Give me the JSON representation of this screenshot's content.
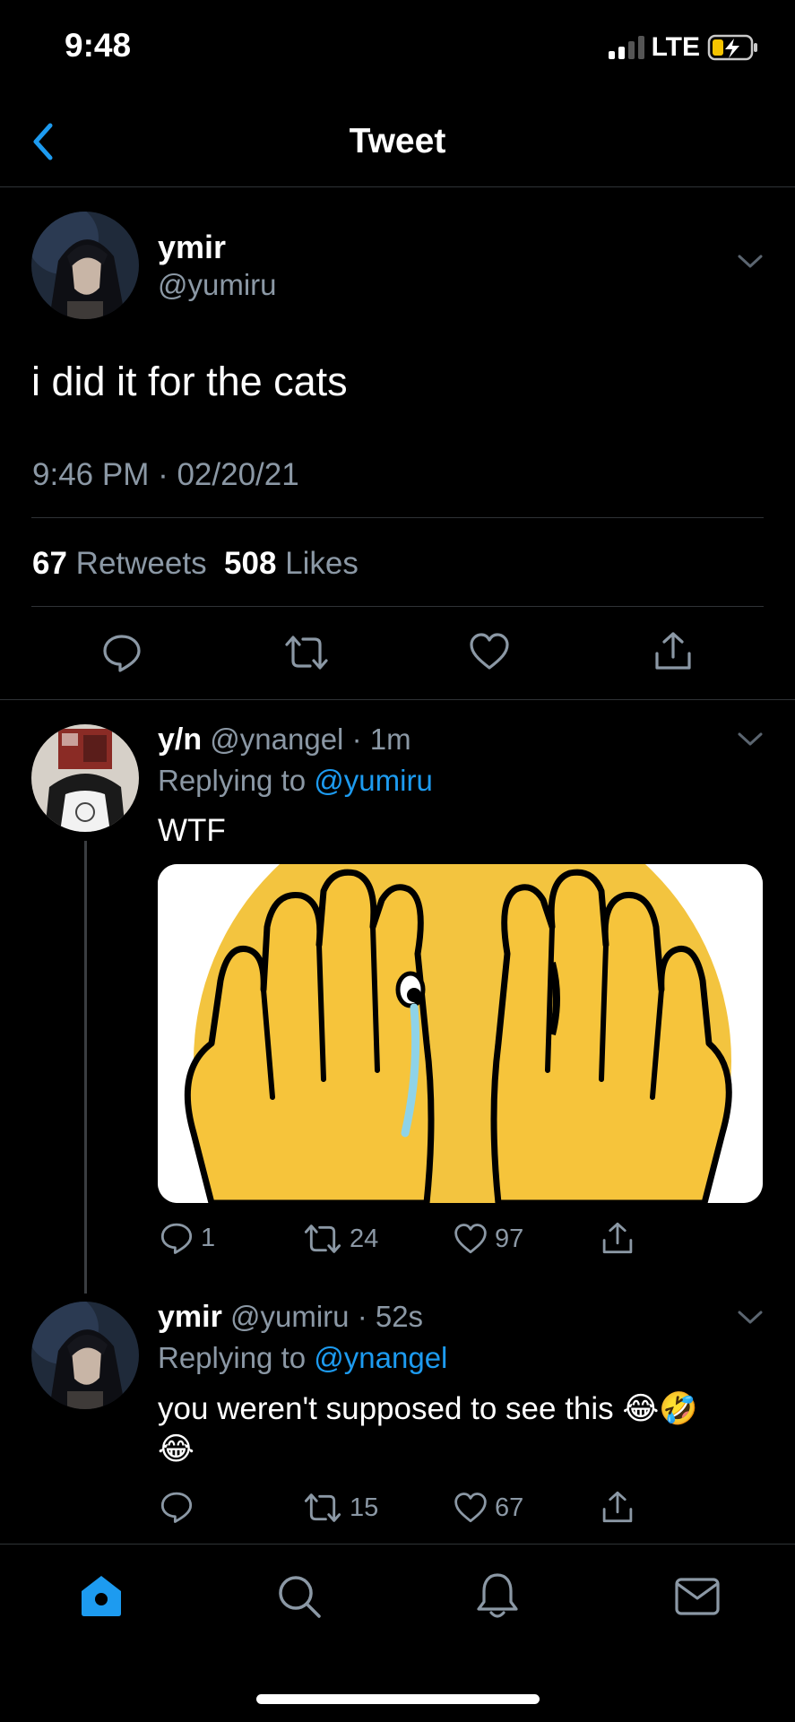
{
  "status_bar": {
    "time": "9:48",
    "network": "LTE"
  },
  "header": {
    "title": "Tweet"
  },
  "main_tweet": {
    "name": "ymir",
    "handle": "@yumiru",
    "text": "i did it for the cats",
    "timestamp": "9:46 PM · 02/20/21",
    "retweets_count": "67",
    "retweets_label": "Retweets",
    "likes_count": "508",
    "likes_label": "Likes"
  },
  "replies": [
    {
      "name": "y/n",
      "handle": "@ynangel",
      "time": "· 1m",
      "replying_prefix": "Replying to",
      "replying_to": "@yumiru",
      "text": "WTF",
      "reply_count": "1",
      "retweet_count": "24",
      "like_count": "97"
    },
    {
      "name": "ymir",
      "handle": "@yumiru",
      "time": "· 52s",
      "replying_prefix": "Replying to",
      "replying_to": "@ynangel",
      "text": "you weren't supposed to see this 😂🤣",
      "text_line2": "😂",
      "reply_count": "",
      "retweet_count": "15",
      "like_count": "67"
    }
  ],
  "tab_bar": {
    "items": [
      "home-icon",
      "search-icon",
      "notifications-icon",
      "messages-icon"
    ],
    "active": "home-icon"
  },
  "colors": {
    "accent": "#1d9bf0",
    "muted": "#8b98a5",
    "background": "#000000"
  }
}
